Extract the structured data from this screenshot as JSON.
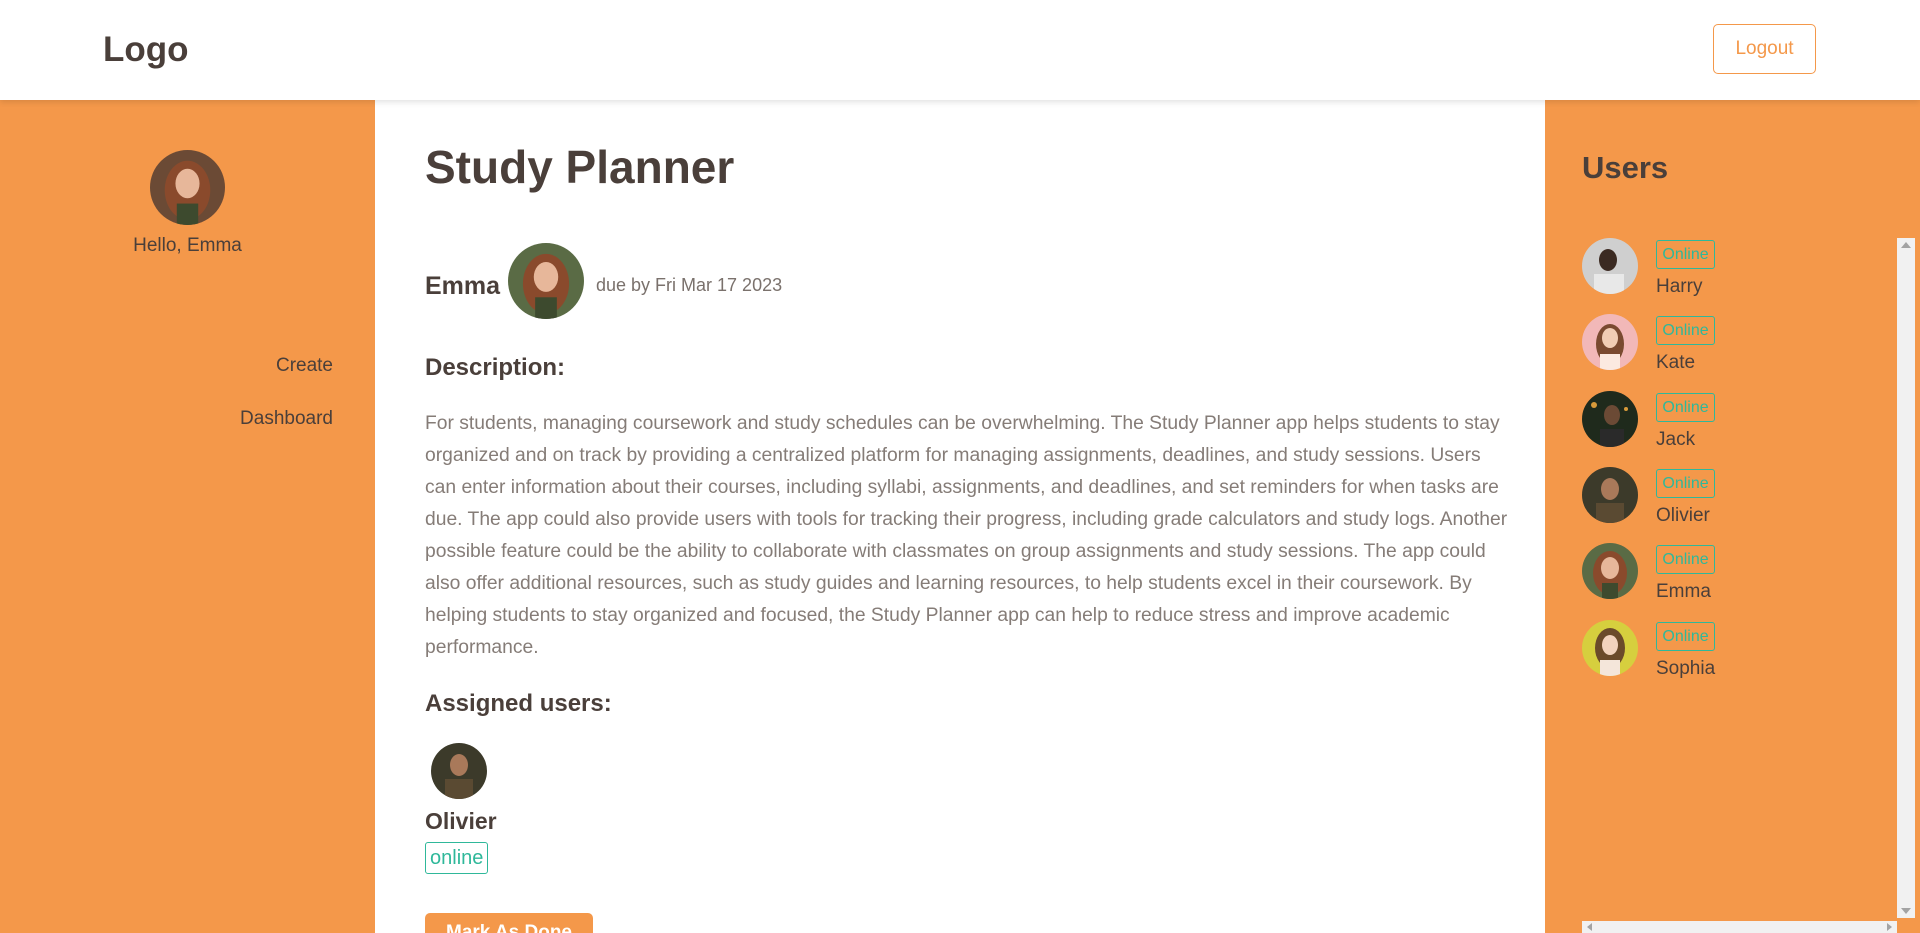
{
  "header": {
    "logo": "Logo",
    "logout_label": "Logout"
  },
  "sidebar": {
    "greeting": "Hello, Emma",
    "avatar_icon": "user-avatar-emma",
    "nav": [
      {
        "label": "Create"
      },
      {
        "label": "Dashboard"
      }
    ]
  },
  "project": {
    "title": "Study Planner",
    "owner": "Emma",
    "due": "due by Fri Mar 17 2023",
    "description_heading": "Description:",
    "description": "For students, managing coursework and study schedules can be overwhelming. The Study Planner app helps students to stay organized and on track by providing a centralized platform for managing assignments, deadlines, and study sessions. Users can enter information about their courses, including syllabi, assignments, and deadlines, and set reminders for when tasks are due. The app could also provide users with tools for tracking their progress, including grade calculators and study logs. Another possible feature could be the ability to collaborate with classmates on group assignments and study sessions. The app could also offer additional resources, such as study guides and learning resources, to help students excel in their coursework. By helping students to stay organized and focused, the Study Planner app can help to reduce stress and improve academic performance.",
    "assigned_heading": "Assigned users:",
    "assigned": [
      {
        "name": "Olivier",
        "status": "online"
      }
    ],
    "action_label": "Mark As Done"
  },
  "users_panel": {
    "title": "Users",
    "users": [
      {
        "name": "Harry",
        "status": "Online"
      },
      {
        "name": "Kate",
        "status": "Online"
      },
      {
        "name": "Jack",
        "status": "Online"
      },
      {
        "name": "Olivier",
        "status": "Online"
      },
      {
        "name": "Emma",
        "status": "Online"
      },
      {
        "name": "Sophia",
        "status": "Online"
      }
    ]
  },
  "colors": {
    "accent": "#f4984a",
    "status_online": "#2fb89a",
    "text_dark": "#4a3f3a",
    "text_muted": "#857c77"
  }
}
